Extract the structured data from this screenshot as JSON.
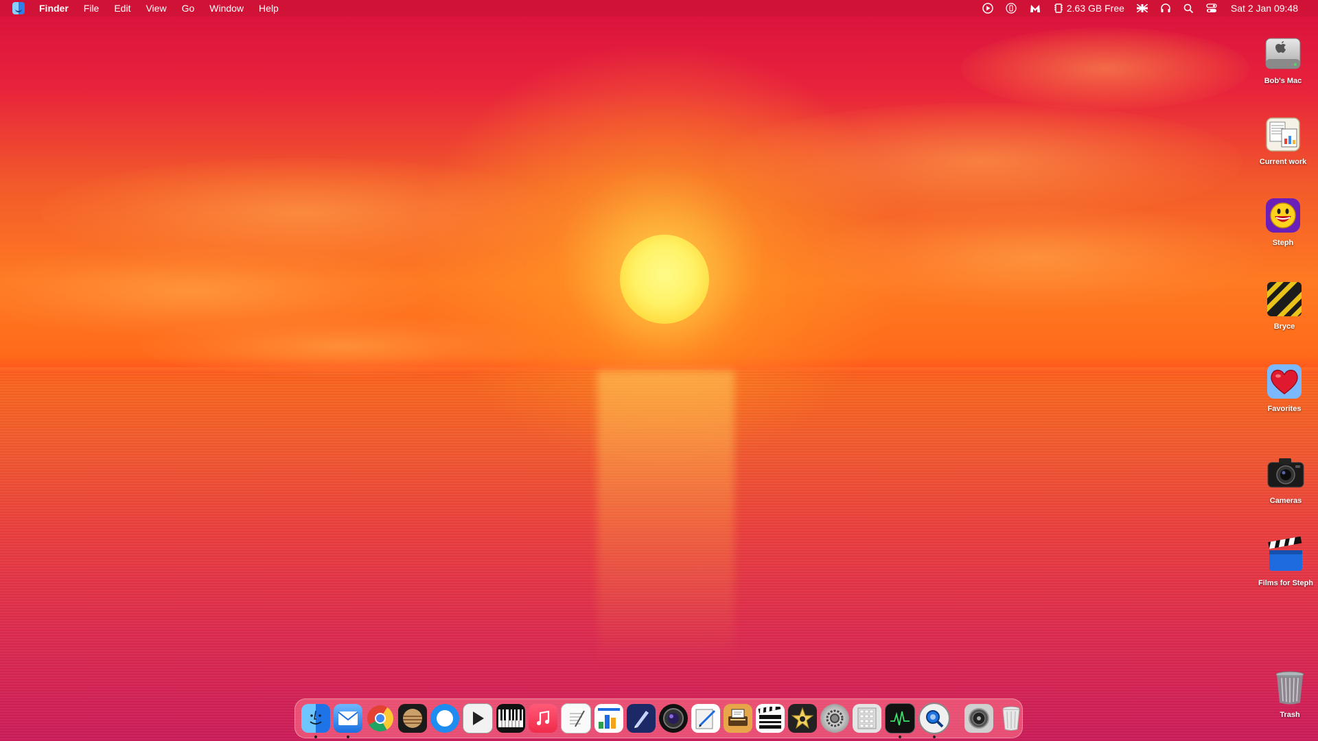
{
  "menubar": {
    "app_name": "Finder",
    "menus": [
      "File",
      "Edit",
      "View",
      "Go",
      "Window",
      "Help"
    ],
    "disk_free": "2.63 GB Free",
    "datetime": "Sat 2 Jan  09:48"
  },
  "desktop_icons": [
    {
      "label": "Bob's Mac",
      "icon": "hard-drive-icon"
    },
    {
      "label": "Current work",
      "icon": "folder-documents-icon"
    },
    {
      "label": "Steph",
      "icon": "yahoo-messenger-icon"
    },
    {
      "label": "Bryce",
      "icon": "hazard-stripes-icon"
    },
    {
      "label": "Favorites",
      "icon": "heart-icon"
    },
    {
      "label": "Cameras",
      "icon": "camera-icon"
    },
    {
      "label": "Films for Steph",
      "icon": "clapperboard-icon"
    },
    {
      "label": "Trash",
      "icon": "trash-icon"
    }
  ],
  "dock": {
    "apps": [
      {
        "name": "finder-icon",
        "running": true
      },
      {
        "name": "mail-icon",
        "running": true
      },
      {
        "name": "chrome-icon",
        "running": false
      },
      {
        "name": "planet-icon",
        "running": false
      },
      {
        "name": "safari-icon",
        "running": false
      },
      {
        "name": "video-player-icon",
        "running": false
      },
      {
        "name": "piano-icon",
        "running": false
      },
      {
        "name": "music-icon",
        "running": false
      },
      {
        "name": "textedit-icon",
        "running": false
      },
      {
        "name": "numbers-icon",
        "running": false
      },
      {
        "name": "pen-app-icon",
        "running": false
      },
      {
        "name": "camera-lens-icon",
        "running": false
      },
      {
        "name": "script-editor-icon",
        "running": false
      },
      {
        "name": "scanner-icon",
        "running": false
      },
      {
        "name": "clapperboard-icon",
        "running": false
      },
      {
        "name": "imovie-star-icon",
        "running": false
      },
      {
        "name": "system-preferences-icon",
        "running": false
      },
      {
        "name": "calculator-icon",
        "running": false
      },
      {
        "name": "activity-monitor-icon",
        "running": true
      },
      {
        "name": "quicktime-icon",
        "running": true
      }
    ],
    "right_apps": [
      {
        "name": "speaker-icon",
        "running": false
      },
      {
        "name": "trash-dock-icon",
        "running": false
      }
    ]
  }
}
